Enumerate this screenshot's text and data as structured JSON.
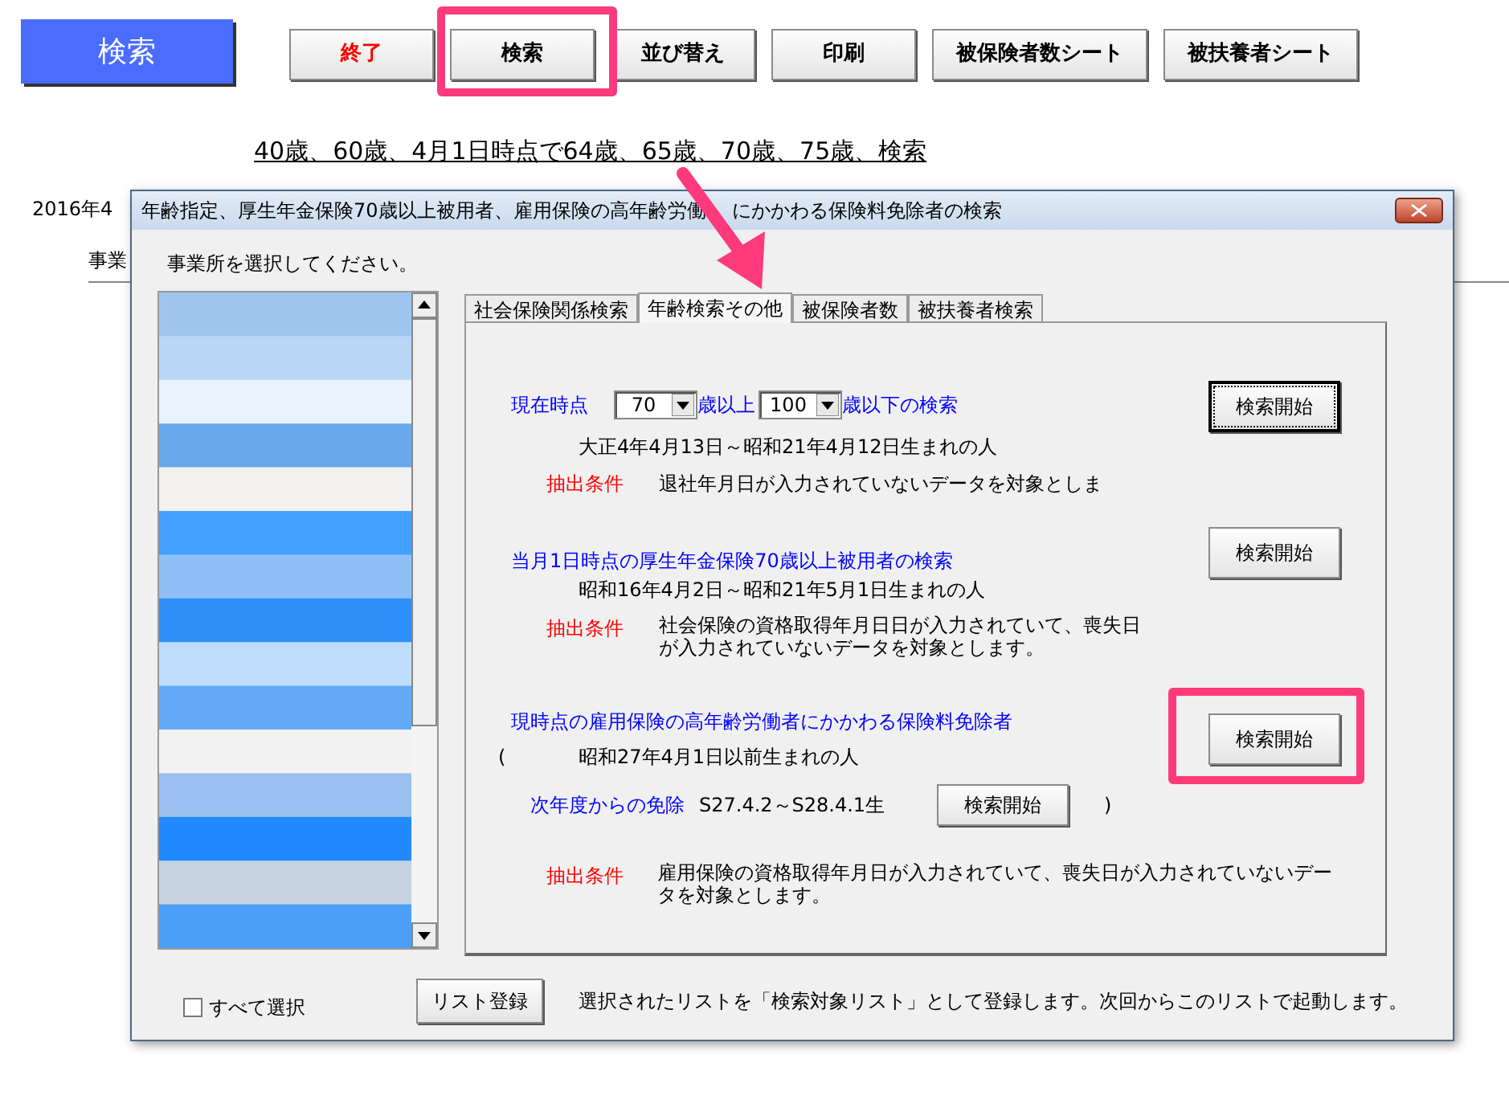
{
  "header": {
    "title": "検索"
  },
  "toolbar": [
    {
      "label": "終了",
      "kind": "danger"
    },
    {
      "label": "検索",
      "kind": "normal"
    },
    {
      "label": "並び替え",
      "kind": "normal"
    },
    {
      "label": "印刷",
      "kind": "normal"
    },
    {
      "label": "被保険者数シート",
      "kind": "normal"
    },
    {
      "label": "被扶養者シート",
      "kind": "normal"
    }
  ],
  "link": "40歳、60歳、4月1日時点で64歳、65歳、70歳、75歳、検索",
  "background_texts": [
    "2016年4",
    "事業"
  ],
  "dialog": {
    "title": "年齢指定、厚生年金保険70歳以上被用者、雇用保険の高年齢労働",
    "title_rest": "にかかわる保険料免除者の検索",
    "prompt": "事業所を選択してください。",
    "tabs": [
      {
        "label": "社会保険関係検索",
        "selected": false
      },
      {
        "label": "年齢検索その他",
        "selected": true
      },
      {
        "label": "被保険者数",
        "selected": false
      },
      {
        "label": "被扶養者検索",
        "selected": false
      }
    ],
    "age_search": {
      "label": "現在時点",
      "from": "70",
      "from_suffix": "歳以上",
      "to": "100",
      "to_suffix": "歳以下の検索",
      "range": "大正4年4月13日～昭和21年4月12日生まれの人",
      "condition_label": "抽出条件",
      "condition": "退社年月日が入力されていないデータを対象としま",
      "button": "検索開始",
      "focused": true
    },
    "pension_search": {
      "heading": "当月1日時点の厚生年金保険70歳以上被用者の検索",
      "range": "昭和16年4月2日～昭和21年5月1日生まれの人",
      "condition_label": "抽出条件",
      "condition": "社会保険の資格取得年月日日が入力されていて、喪失日が入力されていないデータを対象とします。",
      "button": "検索開始",
      "focused": false
    },
    "employment_search": {
      "heading": "現時点の雇用保険の高年齢労働者にかかわる保険料免除者",
      "open_paren": "(",
      "range": "昭和27年4月1日以前生まれの人",
      "next_label": "次年度からの免除",
      "next_range": "S27.4.2～S28.4.1生",
      "next_button": "検索開始",
      "close_paren": ")",
      "condition_label": "抽出条件",
      "condition": "雇用保険の資格取得年月日が入力されていて、喪失日が入力されていないデータを対象とします。",
      "button": "検索開始",
      "focused": false
    },
    "select_all": {
      "label": "すべて選択",
      "checked": false
    },
    "register_button": "リスト登録",
    "register_note": "選択されたリストを「検索対象リスト」として登録します。次回からこのリストで起動します。"
  }
}
